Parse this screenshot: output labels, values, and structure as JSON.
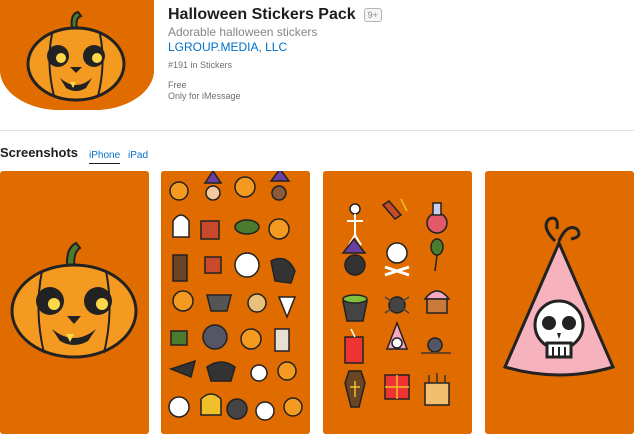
{
  "app": {
    "title": "Halloween Stickers Pack",
    "age_rating": "9+",
    "subtitle": "Adorable halloween stickers",
    "developer": "LGROUP.MEDIA, LLC",
    "rank": "#191 in Stickers",
    "price": "Free",
    "platform": "Only for iMessage",
    "icon": "jack-o-lantern-icon"
  },
  "screenshots": {
    "title": "Screenshots",
    "tabs": [
      {
        "label": "iPhone",
        "selected": true
      },
      {
        "label": "iPad",
        "selected": false
      }
    ],
    "items": [
      {
        "depicts": "jack-o-lantern"
      },
      {
        "depicts": "sticker-pattern"
      },
      {
        "depicts": "sticker-grid"
      },
      {
        "depicts": "skull-party-hat"
      }
    ]
  },
  "colors": {
    "brand_orange": "#e06c00",
    "link_blue": "#0070c9"
  }
}
